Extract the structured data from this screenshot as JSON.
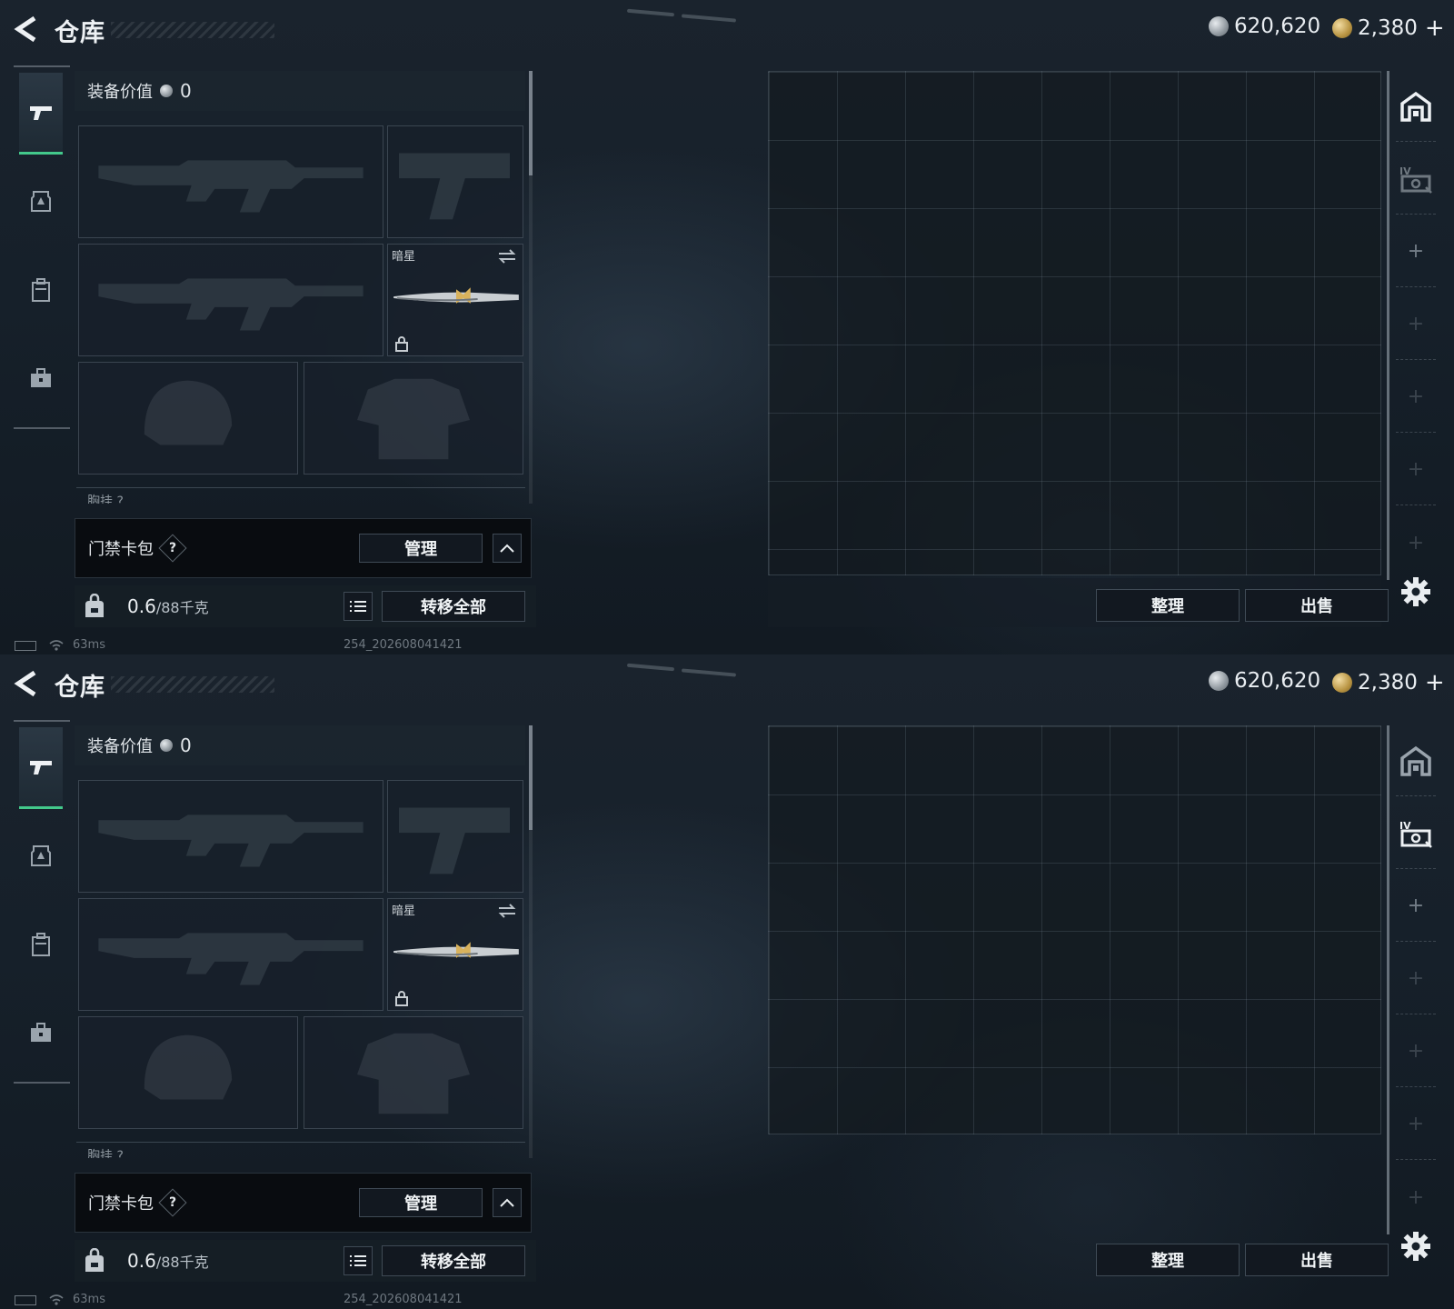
{
  "header": {
    "title": "仓库"
  },
  "currency": {
    "silver": "620,620",
    "gold": "2,380",
    "add": "+"
  },
  "nav": [
    "weapon-icon",
    "armor-icon",
    "backpack-icon",
    "briefcase-icon"
  ],
  "equipment": {
    "label": "装备价值",
    "value": "0",
    "melee_name": "暗星",
    "cut_label": "胸挂 ?"
  },
  "keycard": {
    "label": "门禁卡包",
    "help": "?",
    "manage": "管理"
  },
  "weight": {
    "current": "0.6",
    "max": "/88千克",
    "transfer_all": "转移全部"
  },
  "storage": {
    "sort": "整理",
    "sell": "出售"
  },
  "status": {
    "ping": "63ms",
    "build": "254_202608041421"
  },
  "colors": {
    "accent_green": "#43c98b",
    "panel_bg": "#18202a",
    "button_bg": "#121820"
  },
  "screens": [
    {
      "rail_second_icon_bright": false,
      "grid_rows": 7
    },
    {
      "rail_second_icon_bright": true,
      "grid_rows": 6
    }
  ]
}
